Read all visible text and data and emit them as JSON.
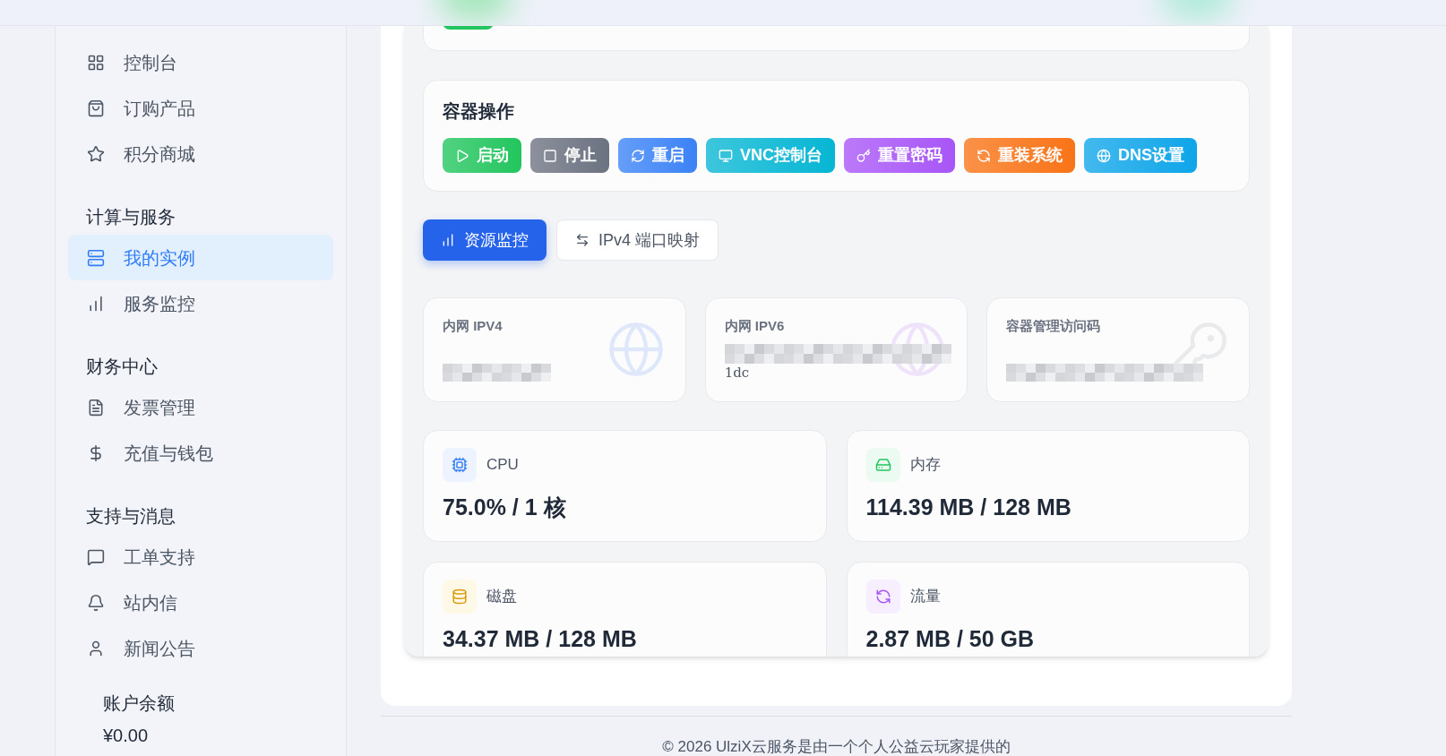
{
  "sidebar": {
    "sections": [
      {
        "items": [
          {
            "label": "控制台",
            "selected": false
          },
          {
            "label": "订购产品",
            "selected": false
          },
          {
            "label": "积分商城",
            "selected": false
          }
        ]
      },
      {
        "title": "计算与服务",
        "items": [
          {
            "label": "我的实例",
            "selected": true
          },
          {
            "label": "服务监控",
            "selected": false
          }
        ]
      },
      {
        "title": "财务中心",
        "items": [
          {
            "label": "发票管理",
            "selected": false
          },
          {
            "label": "充值与钱包",
            "selected": false
          }
        ]
      },
      {
        "title": "支持与消息",
        "items": [
          {
            "label": "工单支持",
            "selected": false
          },
          {
            "label": "站内信",
            "selected": false
          },
          {
            "label": "新闻公告",
            "selected": false
          }
        ]
      }
    ],
    "balance": {
      "label": "账户余额",
      "value": "¥0.00"
    }
  },
  "operations": {
    "title": "容器操作",
    "buttons": [
      {
        "label": "启动",
        "color": "#22c55e"
      },
      {
        "label": "停止",
        "color": "#6b7280"
      },
      {
        "label": "重启",
        "color": "#3b82f6"
      },
      {
        "label": "VNC控制台",
        "color": "#06b6d4"
      },
      {
        "label": "重置密码",
        "color": "#a855f7"
      },
      {
        "label": "重装系统",
        "color": "#f97316"
      },
      {
        "label": "DNS设置",
        "color": "#0ea5e9"
      }
    ]
  },
  "tabs": [
    {
      "label": "资源监控",
      "selected": true
    },
    {
      "label": "IPv4 端口映射",
      "selected": false
    }
  ],
  "info_cards": [
    {
      "label": "内网 IPV4",
      "redacted": true
    },
    {
      "label": "内网 IPV6",
      "redacted": true,
      "value": "1dc"
    },
    {
      "label": "容器管理访问码",
      "redacted": true
    }
  ],
  "stats": [
    {
      "label": "CPU",
      "value": "75.0% / 1 核"
    },
    {
      "label": "内存",
      "value": "114.39 MB / 128 MB"
    },
    {
      "label": "磁盘",
      "value": "34.37 MB / 128 MB"
    },
    {
      "label": "流量",
      "value": "2.87 MB / 50 GB"
    }
  ],
  "footer": {
    "text": "© 2026 UlziX云服务是由一个个人公益云玩家提供的"
  }
}
